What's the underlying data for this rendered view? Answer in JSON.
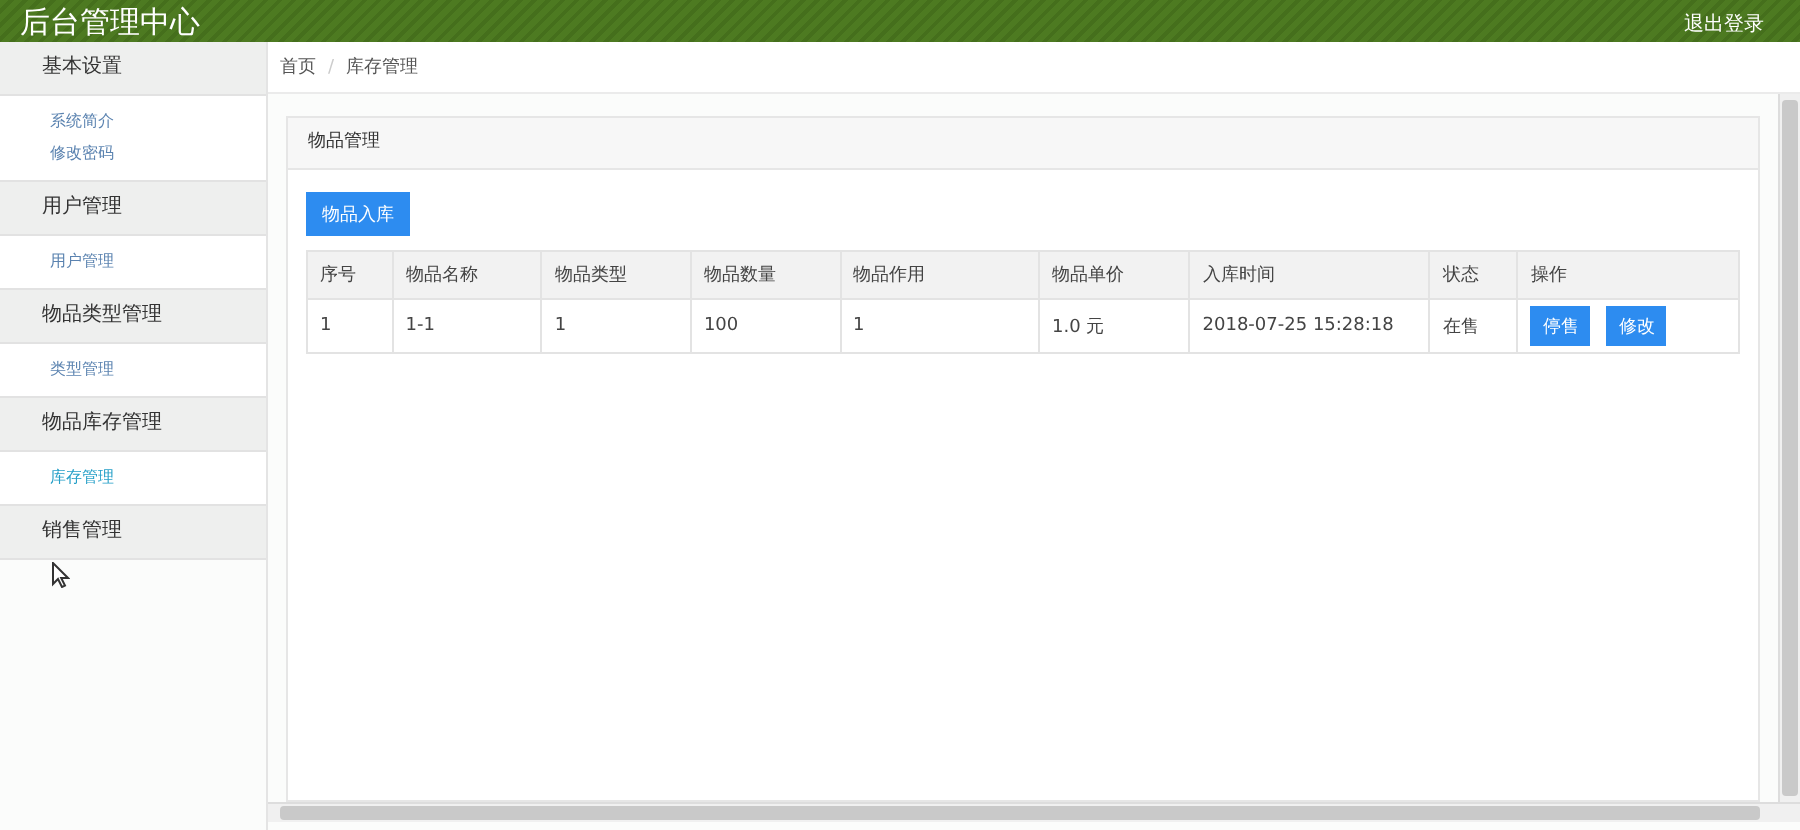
{
  "header": {
    "title": "后台管理中心",
    "logout": "退出登录"
  },
  "sidebar": {
    "groups": [
      {
        "title": "基本设置",
        "items": [
          {
            "label": "系统简介",
            "selected": false
          },
          {
            "label": "修改密码",
            "selected": false
          }
        ]
      },
      {
        "title": "用户管理",
        "items": [
          {
            "label": "用户管理",
            "selected": false
          }
        ]
      },
      {
        "title": "物品类型管理",
        "items": [
          {
            "label": "类型管理",
            "selected": false
          }
        ]
      },
      {
        "title": "物品库存管理",
        "items": [
          {
            "label": "库存管理",
            "selected": true
          }
        ]
      },
      {
        "title": "销售管理"
      }
    ]
  },
  "breadcrumb": {
    "separator": "/",
    "links": [
      "首页",
      "库存管理"
    ]
  },
  "panel": {
    "title": "物品管理",
    "add_button": "物品入库",
    "table": {
      "columns": [
        "序号",
        "物品名称",
        "物品类型",
        "物品数量",
        "物品作用",
        "物品单价",
        "入库时间",
        "状态",
        "操作"
      ],
      "rows": [
        {
          "cells": [
            "1",
            "1-1",
            "1",
            "100",
            "1",
            "1.0 元",
            "2018-07-25 15:28:18",
            "在售"
          ],
          "actions": [
            "停售",
            "修改"
          ]
        }
      ]
    }
  }
}
